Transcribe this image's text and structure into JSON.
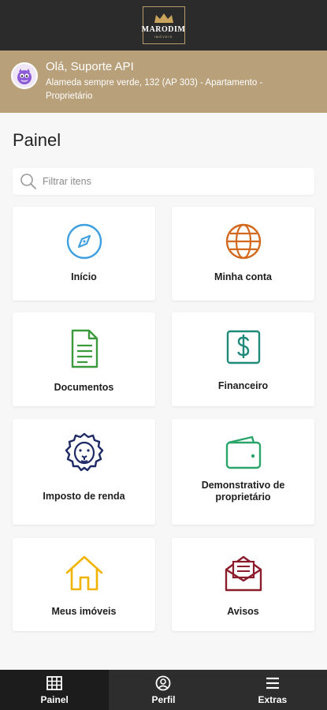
{
  "header": {
    "logo_name": "MARODIM",
    "logo_sub": "IMÓVEIS"
  },
  "user": {
    "greeting": "Olá, Suporte API",
    "address": "Alameda sempre verde, 132 (AP 303) - Apartamento - Proprietário"
  },
  "page": {
    "title": "Painel",
    "search_placeholder": "Filtrar itens"
  },
  "cards": [
    {
      "label": "Início",
      "icon": "compass-icon",
      "color": "#3ea0e0"
    },
    {
      "label": "Minha conta",
      "icon": "globe-icon",
      "color": "#d2691e"
    },
    {
      "label": "Documentos",
      "icon": "document-icon",
      "color": "#3b9a3b"
    },
    {
      "label": "Financeiro",
      "icon": "dollar-icon",
      "color": "#1f8a7a"
    },
    {
      "label": "Imposto de renda",
      "icon": "lion-icon",
      "color": "#1e2a66"
    },
    {
      "label": "Demonstrativo de proprietário",
      "icon": "wallet-icon",
      "color": "#2aa56a"
    },
    {
      "label": "Meus imóveis",
      "icon": "house-icon",
      "color": "#f0b400"
    },
    {
      "label": "Avisos",
      "icon": "envelope-icon",
      "color": "#8a1c2c"
    }
  ],
  "nav": {
    "tabs": [
      {
        "label": "Painel",
        "icon": "grid-icon",
        "active": true
      },
      {
        "label": "Perfil",
        "icon": "user-icon",
        "active": false
      },
      {
        "label": "Extras",
        "icon": "menu-icon",
        "active": false
      }
    ]
  }
}
